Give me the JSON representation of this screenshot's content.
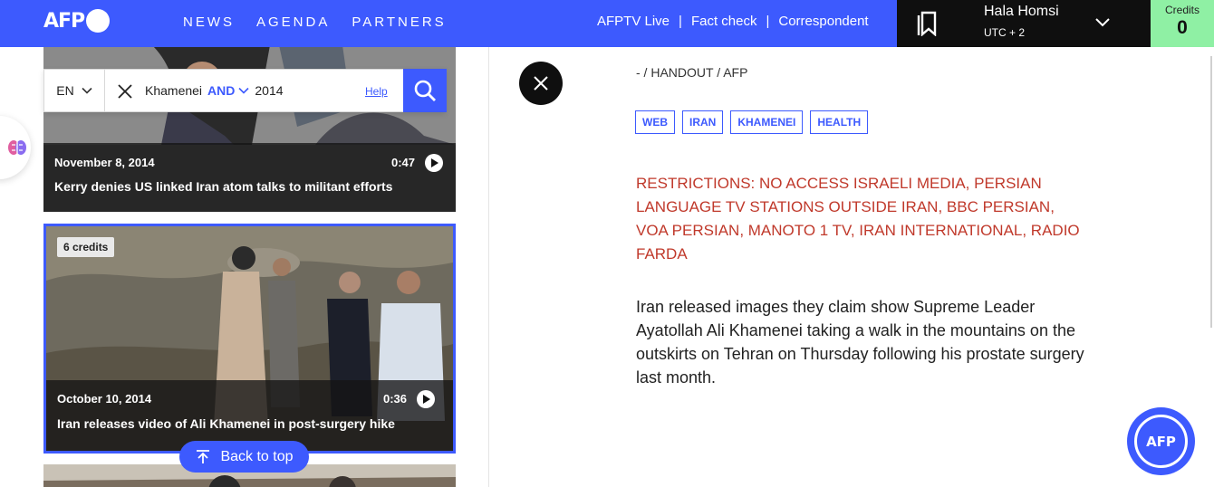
{
  "header": {
    "logo_text": "AFP",
    "nav": [
      "NEWS",
      "AGENDA",
      "PARTNERS"
    ],
    "links": [
      "AFPTV Live",
      "Fact check",
      "Correspondent"
    ],
    "separator": "|",
    "user": {
      "name": "Hala Homsi",
      "timezone": "UTC + 2"
    },
    "credits": {
      "label": "Credits",
      "value": "0"
    }
  },
  "search": {
    "language": "EN",
    "keyword1": "Khamenei",
    "operator": "AND",
    "keyword2": "2014",
    "help_label": "Help"
  },
  "results": [
    {
      "date": "November 8, 2014",
      "duration": "0:47",
      "title": "Kerry denies US linked Iran atom talks to militant efforts"
    },
    {
      "credits_badge": "6 credits",
      "date": "October 10, 2014",
      "duration": "0:36",
      "title": "Iran releases video of Ali Khamenei in post-surgery hike"
    }
  ],
  "back_to_top_label": "Back to top",
  "detail": {
    "source": "- / HANDOUT / AFP",
    "tags": [
      "WEB",
      "IRAN",
      "KHAMENEI",
      "HEALTH"
    ],
    "restrictions": "RESTRICTIONS: NO ACCESS ISRAELI MEDIA, PERSIAN LANGUAGE TV STATIONS OUTSIDE IRAN, BBC PERSIAN, VOA PERSIAN, MANOTO 1 TV, IRAN INTERNATIONAL, RADIO FARDA",
    "description": "Iran released images they claim show Supreme Leader Ayatollah Ali Khamenei taking a walk in the mountains on the outskirts on Tehran on Thursday following his prostate surgery last month."
  },
  "chat_label": "AFP",
  "colors": {
    "brand_blue": "#3d5afe",
    "credits_green": "#8ff0a4",
    "restriction_red": "#c0392b",
    "dark": "#0f0f0f"
  }
}
